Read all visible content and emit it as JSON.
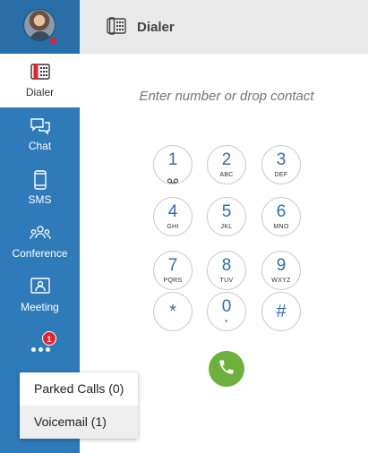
{
  "sidebar": {
    "nav": [
      {
        "label": "Dialer",
        "icon": "dialer-icon"
      },
      {
        "label": "Chat",
        "icon": "chat-icon"
      },
      {
        "label": "SMS",
        "icon": "sms-icon"
      },
      {
        "label": "Conference",
        "icon": "conference-icon"
      },
      {
        "label": "Meeting",
        "icon": "meeting-icon"
      }
    ],
    "more_badge": "1",
    "presence_color": "#e8202a"
  },
  "menu": {
    "items": [
      {
        "label": "Parked Calls (0)"
      },
      {
        "label": "Voicemail (1)"
      }
    ]
  },
  "header": {
    "title": "Dialer",
    "icon": "dialer-icon"
  },
  "dialer": {
    "placeholder": "Enter number or drop contact",
    "keys": [
      {
        "digit": "1",
        "letters": ""
      },
      {
        "digit": "2",
        "letters": "ABC"
      },
      {
        "digit": "3",
        "letters": "DEF"
      },
      {
        "digit": "4",
        "letters": "GHI"
      },
      {
        "digit": "5",
        "letters": "JKL"
      },
      {
        "digit": "6",
        "letters": "MNO"
      },
      {
        "digit": "7",
        "letters": "PQRS"
      },
      {
        "digit": "8",
        "letters": "TUV"
      },
      {
        "digit": "9",
        "letters": "WXYZ"
      },
      {
        "digit": "*",
        "letters": ""
      },
      {
        "digit": "0",
        "letters": "+"
      },
      {
        "digit": "#",
        "letters": ""
      }
    ]
  },
  "colors": {
    "sidebar": "#2f7ab8",
    "accent": "#2f6fad",
    "call": "#6cb13c",
    "badge": "#e0252f"
  }
}
